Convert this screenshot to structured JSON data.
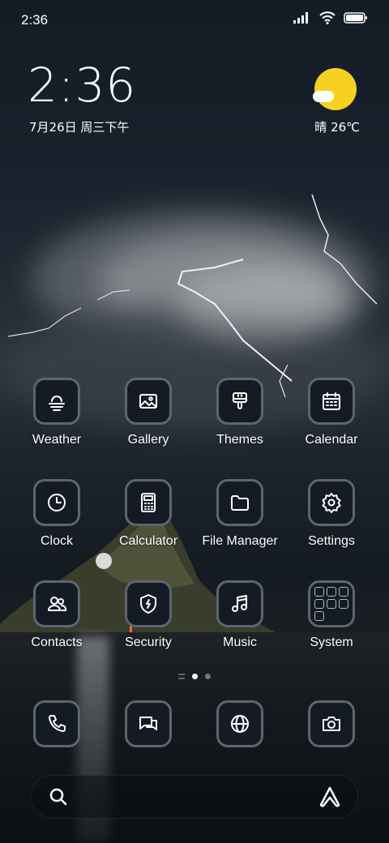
{
  "status_bar": {
    "time": "2:36",
    "icons": [
      "signal-icon",
      "wifi-icon",
      "battery-icon"
    ]
  },
  "clock_widget": {
    "time": "2:36",
    "date": "7月26日 周三下午"
  },
  "weather_widget": {
    "condition_icon": "sunny-cloud-icon",
    "text": "晴 26℃"
  },
  "apps": [
    {
      "label": "Weather",
      "icon": "weather-icon"
    },
    {
      "label": "Gallery",
      "icon": "gallery-icon"
    },
    {
      "label": "Themes",
      "icon": "themes-icon"
    },
    {
      "label": "Calendar",
      "icon": "calendar-icon"
    },
    {
      "label": "Clock",
      "icon": "clock-icon"
    },
    {
      "label": "Calculator",
      "icon": "calculator-icon"
    },
    {
      "label": "File Manager",
      "icon": "folder-icon"
    },
    {
      "label": "Settings",
      "icon": "gear-icon"
    },
    {
      "label": "Contacts",
      "icon": "contacts-icon"
    },
    {
      "label": "Security",
      "icon": "shield-icon"
    },
    {
      "label": "Music",
      "icon": "music-icon"
    },
    {
      "label": "System",
      "icon": "system-folder-icon"
    }
  ],
  "page_indicator": {
    "pages": 2,
    "current": 1
  },
  "dock": [
    {
      "icon": "phone-icon"
    },
    {
      "icon": "messages-icon"
    },
    {
      "icon": "browser-icon"
    },
    {
      "icon": "camera-icon"
    }
  ],
  "search_bar": {
    "icon_left": "search-icon",
    "icon_right": "assistant-icon"
  },
  "colors": {
    "sun": "#f7d11f",
    "tile_border": "#5d6670",
    "tile_bg": "#141b25"
  }
}
